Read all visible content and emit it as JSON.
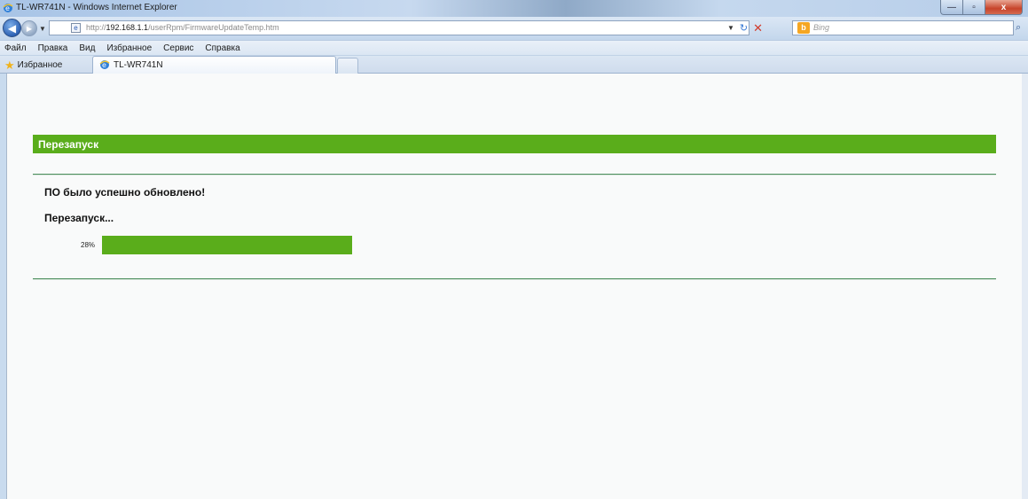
{
  "window": {
    "title": "TL-WR741N - Windows Internet Explorer",
    "controls": {
      "minimize": "—",
      "maximize": "▫",
      "close": "x"
    }
  },
  "addressbar": {
    "url_prefix": "http://",
    "url_host": "192.168.1.1",
    "url_path": "/userRpm/FirmwareUpdateTemp.htm"
  },
  "search": {
    "engine_badge": "b",
    "placeholder": "Bing"
  },
  "menu": {
    "items": [
      "Файл",
      "Правка",
      "Вид",
      "Избранное",
      "Сервис",
      "Справка"
    ]
  },
  "favorites": {
    "label": "Избранное"
  },
  "tabs": [
    {
      "label": "TL-WR741N"
    }
  ],
  "page": {
    "header": "Перезапуск",
    "success_message": "ПО было успешно обновлено!",
    "restart_message": "Перезапуск...",
    "progress_label": "28%"
  },
  "colors": {
    "accent_green": "#5aad1b",
    "rule_green": "#4e8f5e"
  }
}
